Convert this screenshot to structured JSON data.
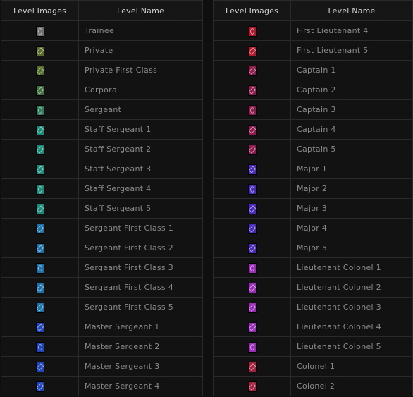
{
  "headers": {
    "level_images": "Level Images",
    "level_name": "Level Name"
  },
  "ranks_left": [
    {
      "name": "Trainee",
      "icon": "trainee-insignia-icon",
      "color": "#6f6f6f"
    },
    {
      "name": "Private",
      "icon": "private-insignia-icon",
      "color": "#5b6a2a"
    },
    {
      "name": "Private First Class",
      "icon": "private-first-class-insignia-icon",
      "color": "#55702c"
    },
    {
      "name": "Corporal",
      "icon": "corporal-insignia-icon",
      "color": "#3f7040"
    },
    {
      "name": "Sergeant",
      "icon": "sergeant-insignia-icon",
      "color": "#2f7a5a"
    },
    {
      "name": "Staff Sergeant 1",
      "icon": "staff-sergeant-insignia-icon",
      "color": "#1b8a78"
    },
    {
      "name": "Staff Sergeant 2",
      "icon": "staff-sergeant-insignia-icon",
      "color": "#1b8a78"
    },
    {
      "name": "Staff Sergeant 3",
      "icon": "staff-sergeant-insignia-icon",
      "color": "#1b8a78"
    },
    {
      "name": "Staff Sergeant 4",
      "icon": "staff-sergeant-insignia-icon",
      "color": "#1b8a78"
    },
    {
      "name": "Staff Sergeant 5",
      "icon": "staff-sergeant-insignia-icon",
      "color": "#1b8a78"
    },
    {
      "name": "Sergeant First Class 1",
      "icon": "sergeant-first-class-insignia-icon",
      "color": "#1c72a8"
    },
    {
      "name": "Sergeant First Class 2",
      "icon": "sergeant-first-class-insignia-icon",
      "color": "#1c72a8"
    },
    {
      "name": "Sergeant First Class 3",
      "icon": "sergeant-first-class-insignia-icon",
      "color": "#1c72a8"
    },
    {
      "name": "Sergeant First Class 4",
      "icon": "sergeant-first-class-insignia-icon",
      "color": "#1c72a8"
    },
    {
      "name": "Sergeant First Class 5",
      "icon": "sergeant-first-class-insignia-icon",
      "color": "#1c72a8"
    },
    {
      "name": "Master Sergeant 1",
      "icon": "master-sergeant-insignia-icon",
      "color": "#1f45b8"
    },
    {
      "name": "Master Sergeant 2",
      "icon": "master-sergeant-insignia-icon",
      "color": "#1f45b8"
    },
    {
      "name": "Master Sergeant 3",
      "icon": "master-sergeant-insignia-icon",
      "color": "#1f45b8"
    },
    {
      "name": "Master Sergeant 4",
      "icon": "master-sergeant-insignia-icon",
      "color": "#1f45b8"
    }
  ],
  "ranks_right": [
    {
      "name": "First Lieutenant 4",
      "icon": "first-lieutenant-insignia-icon",
      "color": "#b0182c"
    },
    {
      "name": "First Lieutenant 5",
      "icon": "first-lieutenant-insignia-icon",
      "color": "#b0182c"
    },
    {
      "name": "Captain 1",
      "icon": "captain-insignia-icon",
      "color": "#8c1a4c"
    },
    {
      "name": "Captain 2",
      "icon": "captain-insignia-icon",
      "color": "#8c1a4c"
    },
    {
      "name": "Captain 3",
      "icon": "captain-insignia-icon",
      "color": "#8c1a4c"
    },
    {
      "name": "Captain 4",
      "icon": "captain-insignia-icon",
      "color": "#8c1a4c"
    },
    {
      "name": "Captain 5",
      "icon": "captain-insignia-icon",
      "color": "#8c1a4c"
    },
    {
      "name": "Major 1",
      "icon": "major-insignia-icon",
      "color": "#4a2ab8"
    },
    {
      "name": "Major 2",
      "icon": "major-insignia-icon",
      "color": "#4a2ab8"
    },
    {
      "name": "Major 3",
      "icon": "major-insignia-icon",
      "color": "#4a2ab8"
    },
    {
      "name": "Major 4",
      "icon": "major-insignia-icon",
      "color": "#4a2ab8"
    },
    {
      "name": "Major 5",
      "icon": "major-insignia-icon",
      "color": "#4a2ab8"
    },
    {
      "name": "Lieutenant Colonel 1",
      "icon": "lieutenant-colonel-insignia-icon",
      "color": "#9a2cb8"
    },
    {
      "name": "Lieutenant Colonel 2",
      "icon": "lieutenant-colonel-insignia-icon",
      "color": "#9a2cb8"
    },
    {
      "name": "Lieutenant Colonel 3",
      "icon": "lieutenant-colonel-insignia-icon",
      "color": "#9a2cb8"
    },
    {
      "name": "Lieutenant Colonel 4",
      "icon": "lieutenant-colonel-insignia-icon",
      "color": "#9a2cb8"
    },
    {
      "name": "Lieutenant Colonel 5",
      "icon": "lieutenant-colonel-insignia-icon",
      "color": "#9a2cb8"
    },
    {
      "name": "Colonel 1",
      "icon": "colonel-insignia-icon",
      "color": "#a2223e"
    },
    {
      "name": "Colonel 2",
      "icon": "colonel-insignia-icon",
      "color": "#a2223e"
    }
  ]
}
